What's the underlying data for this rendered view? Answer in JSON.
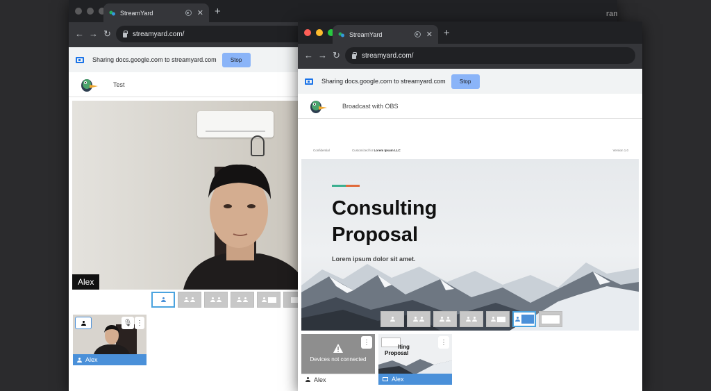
{
  "background_window": {
    "tab": {
      "title": "StreamYard"
    },
    "url": "streamyard.com/",
    "sharing": {
      "text": "Sharing docs.google.com to streamyard.com",
      "stop_label": "Stop"
    },
    "header": {
      "title": "Test"
    },
    "stage": {
      "name": "Alex"
    },
    "participant": {
      "name": "Alex"
    },
    "edge_text": "ram"
  },
  "front_window": {
    "tab": {
      "title": "StreamYard"
    },
    "url": "streamyard.com/",
    "sharing": {
      "text": "Sharing docs.google.com to streamyard.com",
      "stop_label": "Stop"
    },
    "header": {
      "title": "Broadcast with OBS"
    },
    "slide": {
      "top_left": "Confidential",
      "top_middle_prefix": "Customized for",
      "top_middle_bold": "Lorem Ipsum LLC",
      "top_right": "Version 1.0",
      "title_line1": "Consulting",
      "title_line2": "Proposal",
      "subtitle": "Lorem ipsum dolor sit amet."
    },
    "thumbs": [
      {
        "status": "Devices not connected",
        "name": "Alex"
      },
      {
        "preview_line1": "lting",
        "preview_line2": "Proposal",
        "name": "Alex"
      }
    ]
  },
  "colors": {
    "accent_blue": "#4a90d9",
    "stop_button": "#8ab4f8",
    "chrome_dark": "#202124"
  }
}
